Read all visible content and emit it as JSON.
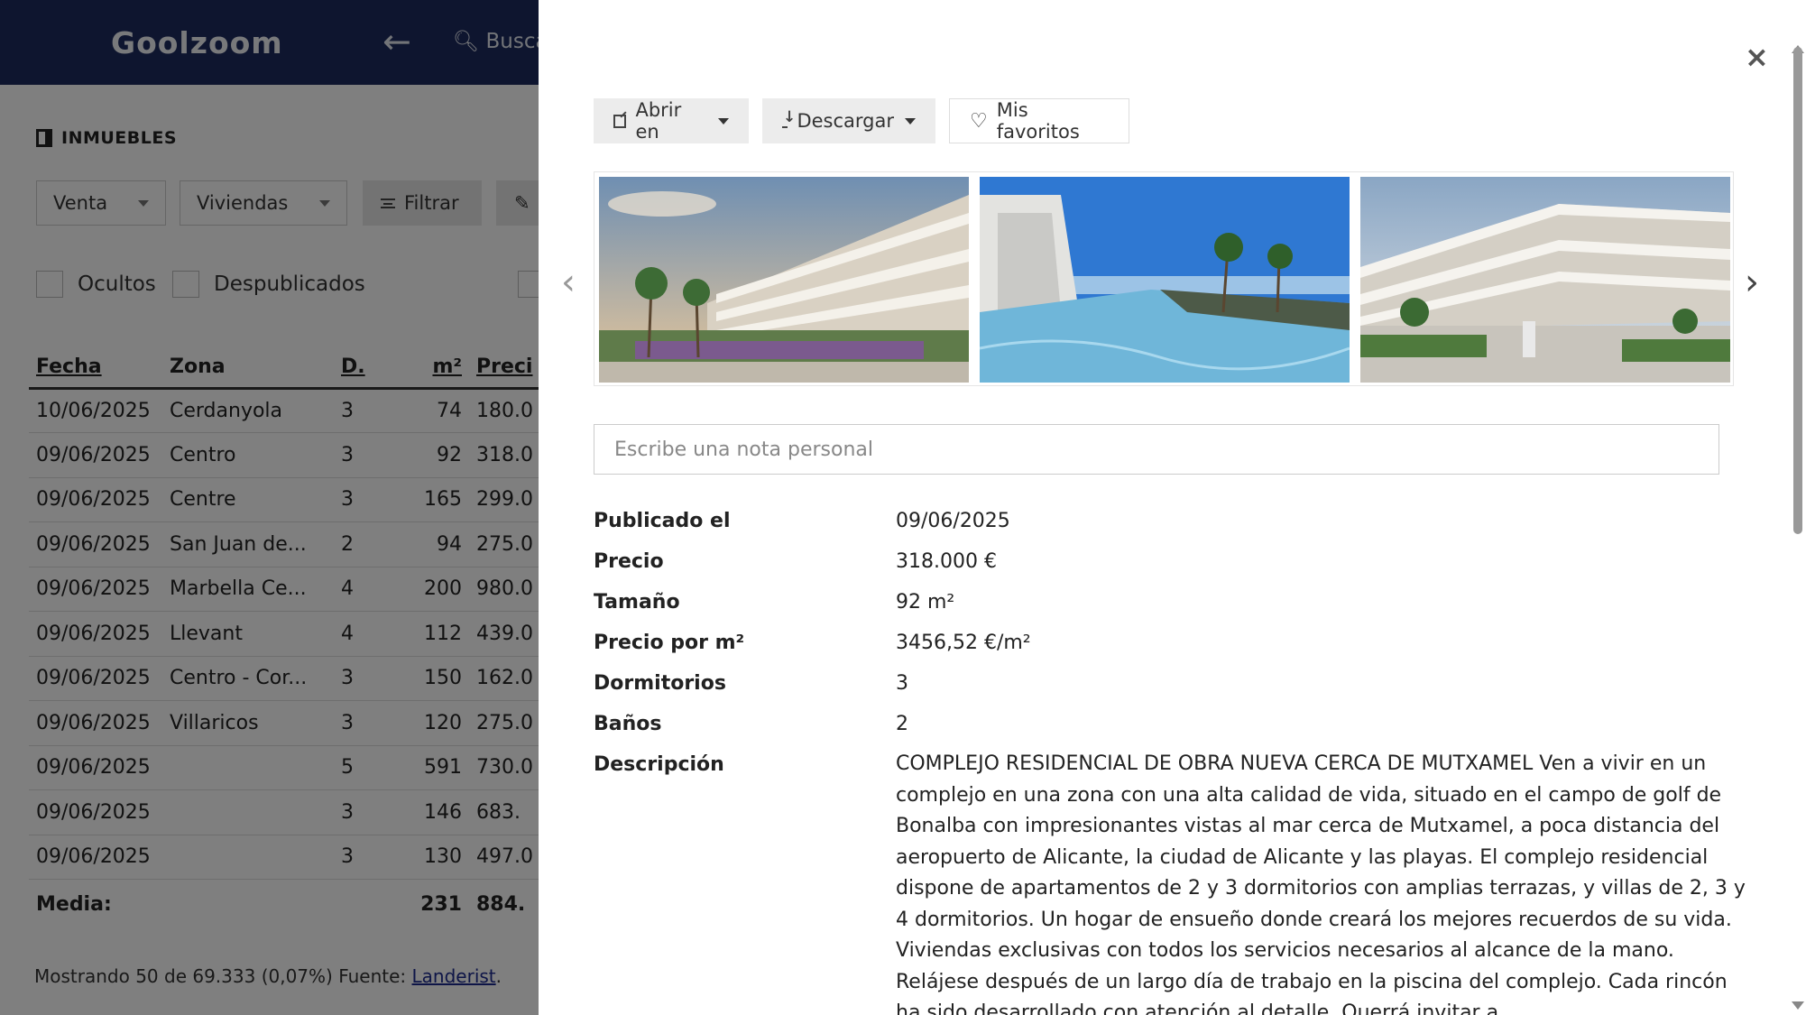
{
  "app": {
    "logo": "Goolzoom",
    "search_label": "Busca",
    "section_title": "INMUEBLES",
    "filters": {
      "operation": "Venta",
      "type": "Viviendas",
      "filter_button": "Filtrar"
    },
    "checkboxes": {
      "hidden": "Ocultos",
      "unpublished": "Despublicados"
    },
    "table": {
      "headers": {
        "date": "Fecha",
        "zone": "Zona",
        "bedrooms": "D.",
        "size": "m²",
        "price": "Preci"
      },
      "rows": [
        {
          "date": "10/06/2025",
          "zone": "Cerdanyola",
          "bedrooms": "3",
          "size": "74",
          "price": "180.0"
        },
        {
          "date": "09/06/2025",
          "zone": "Centro",
          "bedrooms": "3",
          "size": "92",
          "price": "318.0"
        },
        {
          "date": "09/06/2025",
          "zone": "Centre",
          "bedrooms": "3",
          "size": "165",
          "price": "299.0"
        },
        {
          "date": "09/06/2025",
          "zone": "San Juan de...",
          "bedrooms": "2",
          "size": "94",
          "price": "275.0"
        },
        {
          "date": "09/06/2025",
          "zone": "Marbella Ce...",
          "bedrooms": "4",
          "size": "200",
          "price": "980.0"
        },
        {
          "date": "09/06/2025",
          "zone": "Llevant",
          "bedrooms": "4",
          "size": "112",
          "price": "439.0"
        },
        {
          "date": "09/06/2025",
          "zone": "Centro - Cor...",
          "bedrooms": "3",
          "size": "150",
          "price": "162.0"
        },
        {
          "date": "09/06/2025",
          "zone": "Villaricos",
          "bedrooms": "3",
          "size": "120",
          "price": "275.0"
        },
        {
          "date": "09/06/2025",
          "zone": "",
          "bedrooms": "5",
          "size": "591",
          "price": "730.0"
        },
        {
          "date": "09/06/2025",
          "zone": "",
          "bedrooms": "3",
          "size": "146",
          "price": "683."
        },
        {
          "date": "09/06/2025",
          "zone": "",
          "bedrooms": "3",
          "size": "130",
          "price": "497.0"
        }
      ],
      "average": {
        "label": "Media:",
        "size": "231",
        "price": "884."
      }
    },
    "footer": {
      "text": "Mostrando 50 de 69.333 (0,07%) Fuente: ",
      "source_link": "Landerist",
      "suffix": "."
    }
  },
  "modal": {
    "close": "×",
    "toolbar": {
      "open_in": "Abrir en",
      "download": "Descargar",
      "favorites": "Mis favoritos"
    },
    "note_placeholder": "Escribe una nota personal",
    "details": [
      {
        "label": "Publicado el",
        "value": "09/06/2025"
      },
      {
        "label": "Precio",
        "value": "318.000 €"
      },
      {
        "label": "Tamaño",
        "value": "92 m²"
      },
      {
        "label": "Precio por m²",
        "value": "3456,52 €/m²"
      },
      {
        "label": "Dormitorios",
        "value": "3"
      },
      {
        "label": "Baños",
        "value": "2"
      }
    ],
    "description_label": "Descripción",
    "description": "COMPLEJO RESIDENCIAL DE OBRA NUEVA CERCA DE MUTXAMEL Ven a vivir en un complejo en una zona con una alta calidad de vida, situado en el campo de golf de Bonalba con impresionantes vistas al mar cerca de Mutxamel, a poca distancia del aeropuerto de Alicante, la ciudad de Alicante y las playas. El complejo residencial dispone de apartamentos de 2 y 3 dormitorios con amplias terrazas, y villas de 2, 3 y 4 dormitorios. Un hogar de ensueño donde creará los mejores recuerdos de su vida. Viviendas exclusivas con todos los servicios necesarios al alcance de la mano. Relájese después de un largo día de trabajo en la piscina del complejo. Cada rincón ha sido desarrollado con atención al detalle. Querrá invitar a"
  },
  "colors": {
    "navbar": "#1c2a5e",
    "overlay": "rgba(0,0,0,0.5)",
    "link": "#1c2a8e"
  }
}
